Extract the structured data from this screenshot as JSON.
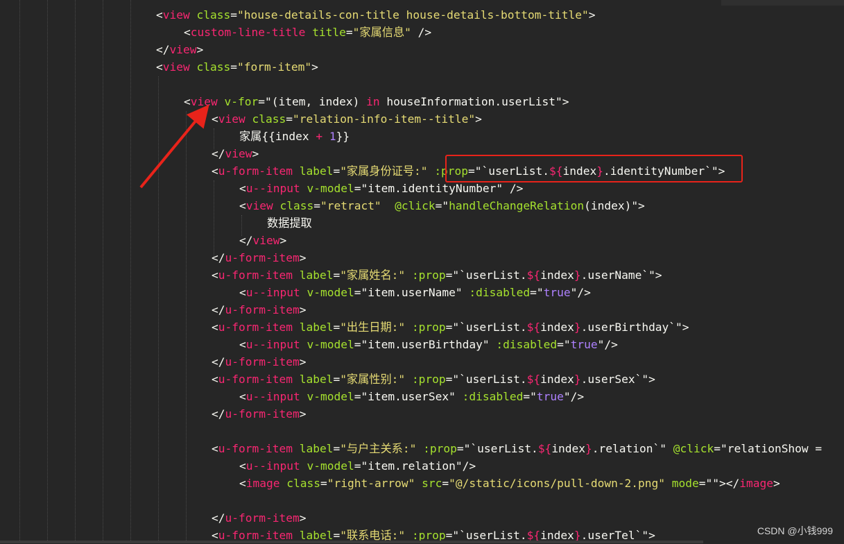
{
  "editor": {
    "lines": [
      [
        [
          "pl",
          "<"
        ],
        [
          "tag",
          "view"
        ],
        [
          "pl",
          " "
        ],
        [
          "attr",
          "class"
        ],
        [
          "pl",
          "="
        ],
        [
          "str",
          "\"house-details-con-title house-details-bottom-title\""
        ],
        [
          "pl",
          ">"
        ]
      ],
      [
        [
          "pl",
          "<"
        ],
        [
          "tag",
          "custom-line-title"
        ],
        [
          "pl",
          " "
        ],
        [
          "attr",
          "title"
        ],
        [
          "pl",
          "="
        ],
        [
          "str",
          "\"家属信息\""
        ],
        [
          "pl",
          " />"
        ]
      ],
      [
        [
          "pl",
          "</"
        ],
        [
          "tag",
          "view"
        ],
        [
          "pl",
          ">"
        ]
      ],
      [
        [
          "pl",
          "<"
        ],
        [
          "tag",
          "view"
        ],
        [
          "pl",
          " "
        ],
        [
          "attr",
          "class"
        ],
        [
          "pl",
          "="
        ],
        [
          "str",
          "\"form-item\""
        ],
        [
          "pl",
          ">"
        ]
      ],
      [],
      [
        [
          "pl",
          "<"
        ],
        [
          "tag",
          "view"
        ],
        [
          "pl",
          " "
        ],
        [
          "attr",
          "v-for"
        ],
        [
          "pl",
          "=\"(item, index) "
        ],
        [
          "kw",
          "in"
        ],
        [
          "pl",
          " houseInformation.userList\">"
        ]
      ],
      [
        [
          "pl",
          "<"
        ],
        [
          "tag",
          "view"
        ],
        [
          "pl",
          " "
        ],
        [
          "attr",
          "class"
        ],
        [
          "pl",
          "="
        ],
        [
          "str",
          "\"relation-info-item--title\""
        ],
        [
          "pl",
          ">"
        ]
      ],
      [
        [
          "pl",
          "家属{{index "
        ],
        [
          "kw",
          "+"
        ],
        [
          "pl",
          " "
        ],
        [
          "num",
          "1"
        ],
        [
          "pl",
          "}}"
        ]
      ],
      [
        [
          "pl",
          "</"
        ],
        [
          "tag",
          "view"
        ],
        [
          "pl",
          ">"
        ]
      ],
      [
        [
          "pl",
          "<"
        ],
        [
          "tag",
          "u-form-item"
        ],
        [
          "pl",
          " "
        ],
        [
          "attr",
          "label"
        ],
        [
          "pl",
          "="
        ],
        [
          "str",
          "\"家属身份证号:\""
        ],
        [
          "pl",
          " "
        ],
        [
          "attr",
          ":prop"
        ],
        [
          "pl",
          "=\"`userList."
        ],
        [
          "kw",
          "${"
        ],
        [
          "pl",
          "index"
        ],
        [
          "kw",
          "}"
        ],
        [
          "pl",
          ".identityNumber`\">"
        ]
      ],
      [
        [
          "pl",
          "<"
        ],
        [
          "tag",
          "u--input"
        ],
        [
          "pl",
          " "
        ],
        [
          "attr",
          "v-model"
        ],
        [
          "pl",
          "=\"item.identityNumber\" />"
        ]
      ],
      [
        [
          "pl",
          "<"
        ],
        [
          "tag",
          "view"
        ],
        [
          "pl",
          " "
        ],
        [
          "attr",
          "class"
        ],
        [
          "pl",
          "="
        ],
        [
          "str",
          "\"retract\""
        ],
        [
          "pl",
          "  "
        ],
        [
          "attr",
          "@click"
        ],
        [
          "pl",
          "=\""
        ],
        [
          "attr",
          "handleChangeRelation"
        ],
        [
          "pl",
          "(index)\">"
        ]
      ],
      [
        [
          "pl",
          "数据提取"
        ]
      ],
      [
        [
          "pl",
          "</"
        ],
        [
          "tag",
          "view"
        ],
        [
          "pl",
          ">"
        ]
      ],
      [
        [
          "pl",
          "</"
        ],
        [
          "tag",
          "u-form-item"
        ],
        [
          "pl",
          ">"
        ]
      ],
      [
        [
          "pl",
          "<"
        ],
        [
          "tag",
          "u-form-item"
        ],
        [
          "pl",
          " "
        ],
        [
          "attr",
          "label"
        ],
        [
          "pl",
          "="
        ],
        [
          "str",
          "\"家属姓名:\""
        ],
        [
          "pl",
          " "
        ],
        [
          "attr",
          ":prop"
        ],
        [
          "pl",
          "=\"`userList."
        ],
        [
          "kw",
          "${"
        ],
        [
          "pl",
          "index"
        ],
        [
          "kw",
          "}"
        ],
        [
          "pl",
          ".userName`\">"
        ]
      ],
      [
        [
          "pl",
          "<"
        ],
        [
          "tag",
          "u--input"
        ],
        [
          "pl",
          " "
        ],
        [
          "attr",
          "v-model"
        ],
        [
          "pl",
          "=\"item.userName\" "
        ],
        [
          "attr",
          ":disabled"
        ],
        [
          "pl",
          "=\""
        ],
        [
          "num",
          "true"
        ],
        [
          "pl",
          "\"/>"
        ]
      ],
      [
        [
          "pl",
          "</"
        ],
        [
          "tag",
          "u-form-item"
        ],
        [
          "pl",
          ">"
        ]
      ],
      [
        [
          "pl",
          "<"
        ],
        [
          "tag",
          "u-form-item"
        ],
        [
          "pl",
          " "
        ],
        [
          "attr",
          "label"
        ],
        [
          "pl",
          "="
        ],
        [
          "str",
          "\"出生日期:\""
        ],
        [
          "pl",
          " "
        ],
        [
          "attr",
          ":prop"
        ],
        [
          "pl",
          "=\"`userList."
        ],
        [
          "kw",
          "${"
        ],
        [
          "pl",
          "index"
        ],
        [
          "kw",
          "}"
        ],
        [
          "pl",
          ".userBirthday`\">"
        ]
      ],
      [
        [
          "pl",
          "<"
        ],
        [
          "tag",
          "u--input"
        ],
        [
          "pl",
          " "
        ],
        [
          "attr",
          "v-model"
        ],
        [
          "pl",
          "=\"item.userBirthday\" "
        ],
        [
          "attr",
          ":disabled"
        ],
        [
          "pl",
          "=\""
        ],
        [
          "num",
          "true"
        ],
        [
          "pl",
          "\"/>"
        ]
      ],
      [
        [
          "pl",
          "</"
        ],
        [
          "tag",
          "u-form-item"
        ],
        [
          "pl",
          ">"
        ]
      ],
      [
        [
          "pl",
          "<"
        ],
        [
          "tag",
          "u-form-item"
        ],
        [
          "pl",
          " "
        ],
        [
          "attr",
          "label"
        ],
        [
          "pl",
          "="
        ],
        [
          "str",
          "\"家属性别:\""
        ],
        [
          "pl",
          " "
        ],
        [
          "attr",
          ":prop"
        ],
        [
          "pl",
          "=\"`userList."
        ],
        [
          "kw",
          "${"
        ],
        [
          "pl",
          "index"
        ],
        [
          "kw",
          "}"
        ],
        [
          "pl",
          ".userSex`\">"
        ]
      ],
      [
        [
          "pl",
          "<"
        ],
        [
          "tag",
          "u--input"
        ],
        [
          "pl",
          " "
        ],
        [
          "attr",
          "v-model"
        ],
        [
          "pl",
          "=\"item.userSex\" "
        ],
        [
          "attr",
          ":disabled"
        ],
        [
          "pl",
          "=\""
        ],
        [
          "num",
          "true"
        ],
        [
          "pl",
          "\"/>"
        ]
      ],
      [
        [
          "pl",
          "</"
        ],
        [
          "tag",
          "u-form-item"
        ],
        [
          "pl",
          ">"
        ]
      ],
      [],
      [
        [
          "pl",
          "<"
        ],
        [
          "tag",
          "u-form-item"
        ],
        [
          "pl",
          " "
        ],
        [
          "attr",
          "label"
        ],
        [
          "pl",
          "="
        ],
        [
          "str",
          "\"与户主关系:\""
        ],
        [
          "pl",
          " "
        ],
        [
          "attr",
          ":prop"
        ],
        [
          "pl",
          "=\"`userList."
        ],
        [
          "kw",
          "${"
        ],
        [
          "pl",
          "index"
        ],
        [
          "kw",
          "}"
        ],
        [
          "pl",
          ".relation`\" "
        ],
        [
          "attr",
          "@click"
        ],
        [
          "pl",
          "=\"relationShow ="
        ]
      ],
      [
        [
          "pl",
          "<"
        ],
        [
          "tag",
          "u--input"
        ],
        [
          "pl",
          " "
        ],
        [
          "attr",
          "v-model"
        ],
        [
          "pl",
          "=\"item.relation\"/>"
        ]
      ],
      [
        [
          "pl",
          "<"
        ],
        [
          "tag",
          "image"
        ],
        [
          "pl",
          " "
        ],
        [
          "attr",
          "class"
        ],
        [
          "pl",
          "="
        ],
        [
          "str",
          "\"right-arrow\""
        ],
        [
          "pl",
          " "
        ],
        [
          "attr",
          "src"
        ],
        [
          "pl",
          "="
        ],
        [
          "str",
          "\"@/static/icons/pull-down-2.png\""
        ],
        [
          "pl",
          " "
        ],
        [
          "attr",
          "mode"
        ],
        [
          "pl",
          "=\"\"></"
        ],
        [
          "tag",
          "image"
        ],
        [
          "pl",
          ">"
        ]
      ],
      [],
      [
        [
          "pl",
          "</"
        ],
        [
          "tag",
          "u-form-item"
        ],
        [
          "pl",
          ">"
        ]
      ],
      [
        [
          "pl",
          "<"
        ],
        [
          "tag",
          "u-form-item"
        ],
        [
          "pl",
          " "
        ],
        [
          "attr",
          "label"
        ],
        [
          "pl",
          "="
        ],
        [
          "str",
          "\"联系电话:\""
        ],
        [
          "pl",
          " "
        ],
        [
          "attr",
          ":prop"
        ],
        [
          "pl",
          "=\"`userList."
        ],
        [
          "kw",
          "${"
        ],
        [
          "pl",
          "index"
        ],
        [
          "kw",
          "}"
        ],
        [
          "pl",
          ".userTel`\">"
        ]
      ]
    ]
  },
  "watermark": "CSDN @小钱999",
  "colors": {
    "background": "#262626",
    "tag": "#f92672",
    "attribute": "#a6e22e",
    "string": "#e6db74",
    "number": "#ae81ff",
    "plain": "#f8f8f2",
    "highlight_box": "#e8231a"
  }
}
